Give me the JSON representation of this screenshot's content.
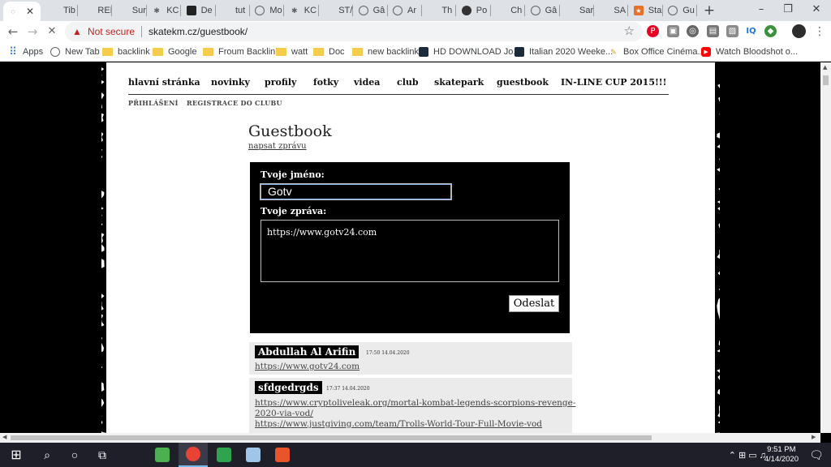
{
  "browser": {
    "tabs": [
      {
        "label": "",
        "icon": "loading-icon",
        "active": true
      },
      {
        "label": "Tib",
        "icon": "blank"
      },
      {
        "label": "REI",
        "icon": "blank"
      },
      {
        "label": "Sur",
        "icon": "blank"
      },
      {
        "label": "KC",
        "icon": "spider-icon"
      },
      {
        "label": "De",
        "icon": "square-icon"
      },
      {
        "label": "tut",
        "icon": "blank"
      },
      {
        "label": "Mo",
        "icon": "globe-icon"
      },
      {
        "label": "KC",
        "icon": "spider-icon"
      },
      {
        "label": "ST/",
        "icon": "blank"
      },
      {
        "label": "Gâ",
        "icon": "globe-icon"
      },
      {
        "label": "Ar",
        "icon": "globe-icon"
      },
      {
        "label": "Th",
        "icon": "blank"
      },
      {
        "label": "Po",
        "icon": "dark-icon"
      },
      {
        "label": "Ch",
        "icon": "blank"
      },
      {
        "label": "Gâ",
        "icon": "globe-icon"
      },
      {
        "label": "Sar",
        "icon": "blank"
      },
      {
        "label": "SA",
        "icon": "blank"
      },
      {
        "label": "Sta",
        "icon": "orange-icon"
      },
      {
        "label": "Gu",
        "icon": "globe-icon"
      }
    ],
    "new_tab_symbol": "+",
    "window_controls": {
      "minimize": "–",
      "restore": "❐",
      "close": "✕"
    },
    "nav": {
      "back": "←",
      "forward": "→",
      "stop": "✕"
    },
    "security_label": "Not secure",
    "url": "skatekm.cz/guestbook/",
    "bookmarks": [
      {
        "label": "Apps",
        "icon": "apps-grid-icon"
      },
      {
        "label": "New Tab",
        "icon": "globe-icon"
      },
      {
        "label": "backlink",
        "icon": "folder-icon"
      },
      {
        "label": "Google",
        "icon": "folder-icon"
      },
      {
        "label": "Froum Backlink",
        "icon": "folder-icon"
      },
      {
        "label": "watt",
        "icon": "folder-icon"
      },
      {
        "label": "Doc",
        "icon": "folder-icon"
      },
      {
        "label": "new backlink",
        "icon": "folder-icon"
      },
      {
        "label": "HD DOWNLOAD Jo...",
        "icon": "tile-icon"
      },
      {
        "label": "Italian 2020 Weeke...",
        "icon": "tile-icon"
      },
      {
        "label": "Box Office Cinéma...",
        "icon": "pin-icon"
      },
      {
        "label": "Watch Bloodshot o...",
        "icon": "youtube-icon"
      }
    ]
  },
  "site": {
    "nav": [
      "hlavní stránka",
      "novinky",
      "profily",
      "fotky",
      "videa",
      "club",
      "skatepark",
      "guestbook",
      "IN-LINE CUP 2015!!!"
    ],
    "subnav": [
      "PŘIHLÁŠENÍ",
      "REGISTRACE DO CLUBU"
    ]
  },
  "guestbook": {
    "title": "Guestbook",
    "new_message_link": "napsat zprávu",
    "form": {
      "name_label": "Tvoje jméno:",
      "name_value": "Gotv",
      "message_label": "Tvoje zpráva:",
      "message_value": "https://www.gotv24.com",
      "submit_label": "Odeslat"
    },
    "entries": [
      {
        "name": "Abdullah Al Arifin",
        "meta": "17:50 14.04.2020",
        "links": [
          "https://www.gotv24.com"
        ]
      },
      {
        "name": "sfdgedrgds",
        "meta": "17:37 14.04.2020",
        "links": [
          "https://www.cryptoliveleak.org/mortal-kombat-legends-scorpions-revenge-",
          "2020-via-vod/",
          "https://www.justgiving.com/team/Trolls-World-Tour-Full-Movie-vod"
        ]
      }
    ]
  },
  "taskbar": {
    "time": "9:51 PM",
    "date": "4/14/2020",
    "tray_symbols": "⌃  ⊞  ▭  ♫"
  },
  "colors": {
    "warning": "#c5221f",
    "focus_border": "#8ab4f8",
    "entry_bg": "#ebebeb"
  }
}
